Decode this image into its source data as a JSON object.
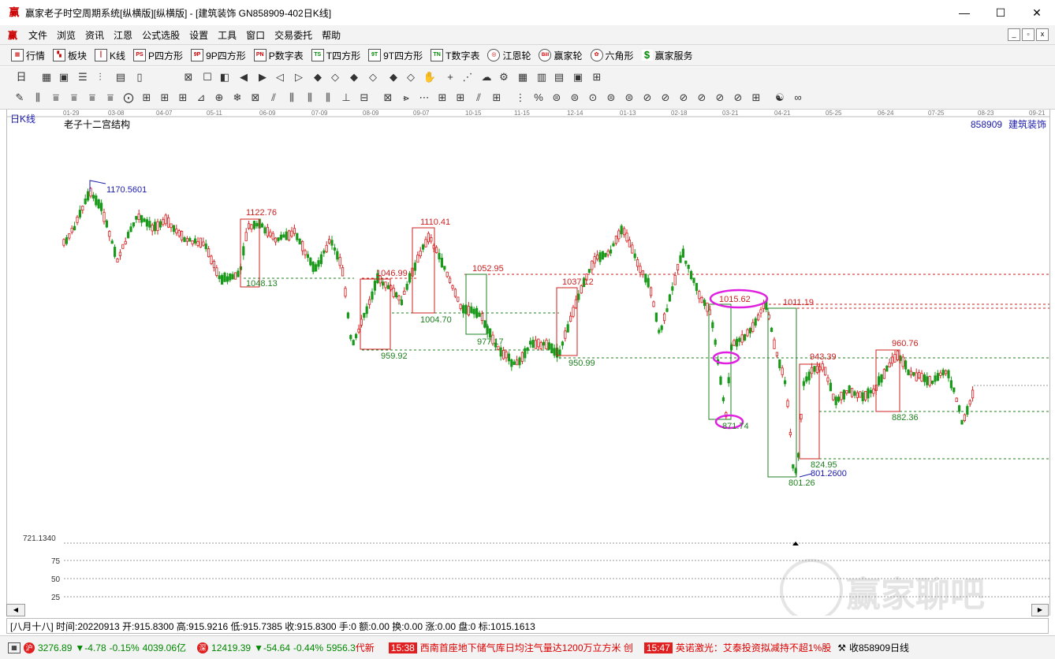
{
  "window": {
    "title": "赢家老子时空周期系统[纵横版][纵横版] - [建筑装饰  GN858909-402日K线]",
    "minimize": "—",
    "maximize": "☐",
    "close": "✕"
  },
  "menu": [
    "文件",
    "浏览",
    "资讯",
    "江恩",
    "公式选股",
    "设置",
    "工具",
    "窗口",
    "交易委托",
    "帮助"
  ],
  "toolbar1": [
    {
      "icon": "grid-icon",
      "label": "行情"
    },
    {
      "icon": "blocks-icon",
      "label": "板块"
    },
    {
      "icon": "kline-icon",
      "label": "K线"
    },
    {
      "icon": "PS",
      "label": "P四方形"
    },
    {
      "icon": "9P",
      "label": "9P四方形"
    },
    {
      "icon": "PN",
      "label": "P数字表"
    },
    {
      "icon": "TS",
      "label": "T四方形"
    },
    {
      "icon": "9T",
      "label": "9T四方形"
    },
    {
      "icon": "TN",
      "label": "T数字表"
    },
    {
      "icon": "circle-icon",
      "label": "江恩轮"
    },
    {
      "icon": "Bill",
      "label": "赢家轮"
    },
    {
      "icon": "hexagon-icon",
      "label": "六角形"
    },
    {
      "icon": "$",
      "label": "赢家服务"
    }
  ],
  "chart": {
    "period_label": "日K线",
    "indicator_title": "老子十二宫结构",
    "code_label": "858909",
    "name_label": "建筑装饰",
    "date_ticks": [
      "01-29",
      "03-08",
      "04-07",
      "05-11",
      "06-09",
      "07-09",
      "08-09",
      "09-07",
      "10-15",
      "11-15",
      "12-14",
      "01-13",
      "02-18",
      "03-21",
      "04-21",
      "05-25",
      "06-24",
      "07-25",
      "08-23",
      "09-21"
    ],
    "price_labels": [
      {
        "text": "1170.5601",
        "color": "#1a1aaa"
      },
      {
        "text": "1122.76",
        "color": "#cc2020"
      },
      {
        "text": "1048.13",
        "color": "#208020"
      },
      {
        "text": "1110.41",
        "color": "#cc2020"
      },
      {
        "text": "1046.99",
        "color": "#cc2020"
      },
      {
        "text": "1004.70",
        "color": "#208020"
      },
      {
        "text": "959.92",
        "color": "#208020"
      },
      {
        "text": "1052.95",
        "color": "#cc2020"
      },
      {
        "text": "977.17",
        "color": "#208020"
      },
      {
        "text": "1037.12",
        "color": "#cc2020"
      },
      {
        "text": "950.99",
        "color": "#208020"
      },
      {
        "text": "1015.62",
        "color": "#cc2020"
      },
      {
        "text": "1011.19",
        "color": "#cc2020"
      },
      {
        "text": "871.74",
        "color": "#208020"
      },
      {
        "text": "943.39",
        "color": "#cc2020"
      },
      {
        "text": "824.95",
        "color": "#208020"
      },
      {
        "text": "801.2600",
        "color": "#1a1aaa"
      },
      {
        "text": "801.26",
        "color": "#208020"
      },
      {
        "text": "960.76",
        "color": "#cc2020"
      },
      {
        "text": "882.36",
        "color": "#208020"
      }
    ],
    "lower_axis": [
      "721.1340",
      "75",
      "50",
      "25"
    ]
  },
  "status": {
    "text": "[八月十八] 时间:20220913 开:915.8300 高:915.9216 低:915.7385 收:915.8300 手:0 额:0.00 换:0.00 涨:0.00 盘:0 标:1015.1613"
  },
  "bottom": {
    "idx1_value": "3276.89",
    "idx1_change": "▼-4.78",
    "idx1_pct": "-0.15%",
    "idx1_amount": "4039.06亿",
    "idx2_value": "12419.39",
    "idx2_change": "▼-54.64",
    "idx2_pct": "-0.44%",
    "idx2_amount": "5956.3",
    "news_tail": "代新",
    "news1_time": "15:38",
    "news1_text": "西南首座地下储气库日均注气量达1200万立方米 创",
    "news2_time": "15:47",
    "news2_text": "英诺激光：艾泰投资拟减持不超1%股",
    "right_label": "收858909日线",
    "watermark": "赢家聊吧"
  }
}
